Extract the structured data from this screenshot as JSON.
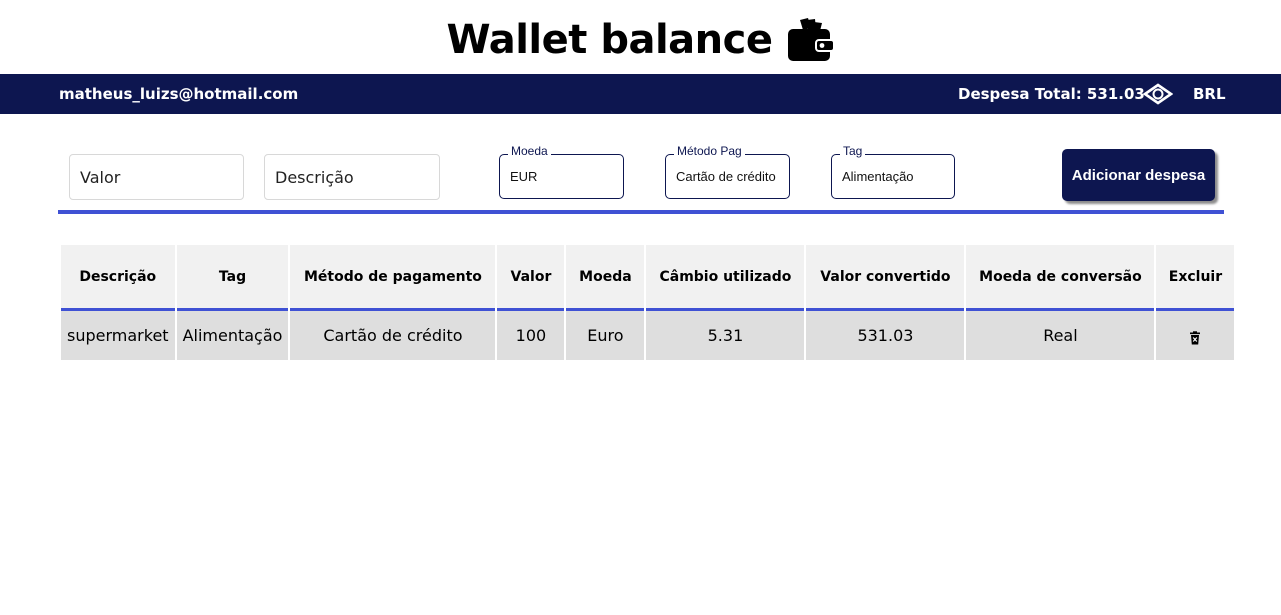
{
  "header": {
    "title": "Wallet balance",
    "icon": "wallet-icon"
  },
  "navbar": {
    "email": "matheus_luizs@hotmail.com",
    "total_text": "Despesa Total: 531.03",
    "currency_icon": "currency-exchange-icon",
    "currency": "BRL",
    "background_color": "#0d1650"
  },
  "form": {
    "valor_placeholder": "Valor",
    "descricao_placeholder": "Descrição",
    "moeda": {
      "label": "Moeda",
      "value": "EUR"
    },
    "metodo": {
      "label": "Método Pag",
      "value": "Cartão de crédito"
    },
    "tag": {
      "label": "Tag",
      "value": "Alimentação"
    },
    "add_button_label": "Adicionar despesa",
    "accent_color": "#3f51d4",
    "field_border_color": "#0d1650"
  },
  "table": {
    "headers": [
      "Descrição",
      "Tag",
      "Método de pagamento",
      "Valor",
      "Moeda",
      "Câmbio utilizado",
      "Valor convertido",
      "Moeda de conversão",
      "Excluir"
    ],
    "rows": [
      [
        "supermarket",
        "Alimentação",
        "Cartão de crédito",
        "100",
        "Euro",
        "5.31",
        "531.03",
        "Real",
        "trash-icon"
      ]
    ]
  }
}
